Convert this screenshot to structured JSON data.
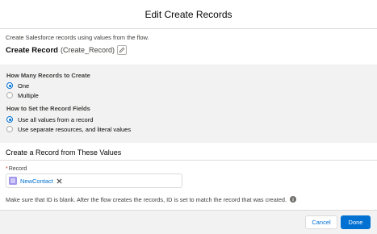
{
  "modal": {
    "title": "Edit Create Records",
    "description": "Create Salesforce records using values from the flow.",
    "element_label": "Create Record",
    "element_api_name": "(Create_Record)"
  },
  "how_many": {
    "label": "How Many Records to Create",
    "options": [
      {
        "label": "One",
        "selected": true
      },
      {
        "label": "Multiple",
        "selected": false
      }
    ]
  },
  "how_set": {
    "label": "How to Set the Record Fields",
    "options": [
      {
        "label": "Use all values from a record",
        "selected": true
      },
      {
        "label": "Use separate resources, and literal values",
        "selected": false
      }
    ]
  },
  "values_section": {
    "heading": "Create a Record from These Values",
    "field_required_marker": "*",
    "field_label": "Record",
    "record_value": "NewContact",
    "note": "Make sure that ID is blank. After the flow creates the records, ID is set to match the record that was created."
  },
  "footer": {
    "cancel_label": "Cancel",
    "done_label": "Done"
  },
  "colors": {
    "brand": "#0070d2",
    "panel_bg": "#f3f2f2",
    "border": "#dddbda"
  }
}
